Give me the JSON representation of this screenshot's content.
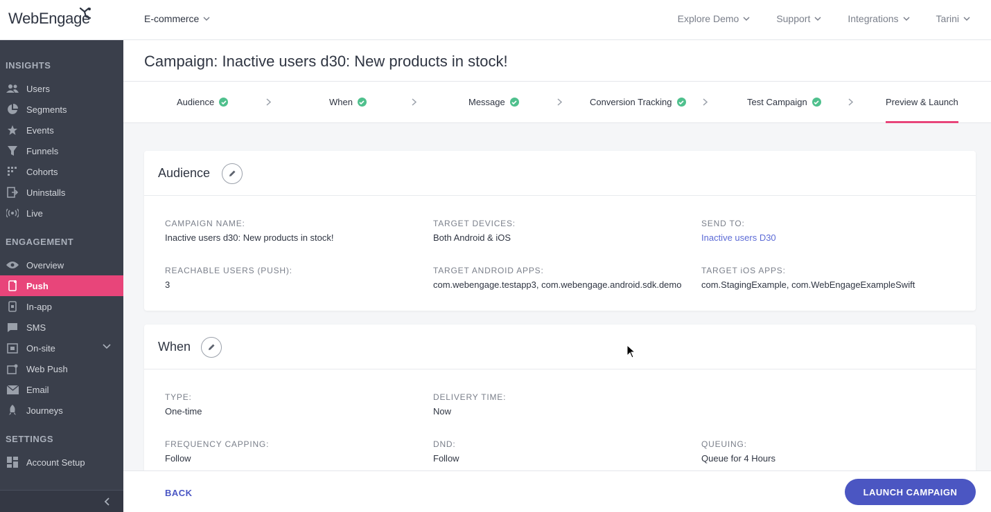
{
  "brand": {
    "logo_text": "WebEngage",
    "accent": "#e8457a",
    "primary": "#4b56c2"
  },
  "header": {
    "workspace": "E-commerce",
    "nav": [
      {
        "label": "Explore Demo"
      },
      {
        "label": "Support"
      },
      {
        "label": "Integrations"
      },
      {
        "label": "Tarini"
      }
    ]
  },
  "sidebar": {
    "sections": [
      {
        "title": "INSIGHTS"
      },
      {
        "title": "ENGAGEMENT"
      },
      {
        "title": "SETTINGS"
      }
    ],
    "items": [
      {
        "label": "Users",
        "icon": "users-icon"
      },
      {
        "label": "Segments",
        "icon": "pie-chart-icon"
      },
      {
        "label": "Events",
        "icon": "star-icon"
      },
      {
        "label": "Funnels",
        "icon": "funnel-icon"
      },
      {
        "label": "Cohorts",
        "icon": "grid-icon"
      },
      {
        "label": "Uninstalls",
        "icon": "exit-icon"
      },
      {
        "label": "Live",
        "icon": "broadcast-icon"
      },
      {
        "label": "Overview",
        "icon": "eye-icon"
      },
      {
        "label": "Push",
        "icon": "mobile-icon",
        "active": true
      },
      {
        "label": "In-app",
        "icon": "in-app-icon"
      },
      {
        "label": "SMS",
        "icon": "sms-icon"
      },
      {
        "label": "On-site",
        "icon": "on-site-icon"
      },
      {
        "label": "Web Push",
        "icon": "web-push-icon"
      },
      {
        "label": "Email",
        "icon": "envelope-icon"
      },
      {
        "label": "Journeys",
        "icon": "rocket-icon"
      },
      {
        "label": "Account Setup",
        "icon": "dashboard-icon"
      }
    ]
  },
  "page": {
    "title": "Campaign: Inactive users d30: New products in stock!"
  },
  "steps": [
    {
      "label": "Audience",
      "done": true
    },
    {
      "label": "When",
      "done": true
    },
    {
      "label": "Message",
      "done": true
    },
    {
      "label": "Conversion Tracking",
      "done": true
    },
    {
      "label": "Test Campaign",
      "done": true
    },
    {
      "label": "Preview & Launch",
      "current": true
    }
  ],
  "audience_card": {
    "title": "Audience",
    "fields": {
      "campaign_name": {
        "label": "CAMPAIGN NAME:",
        "value": "Inactive users d30: New products in stock!"
      },
      "target_devices": {
        "label": "TARGET DEVICES:",
        "value": "Both Android & iOS"
      },
      "send_to": {
        "label": "SEND TO:",
        "value": "Inactive users D30"
      },
      "reachable_users": {
        "label": "REACHABLE USERS (PUSH):",
        "value": "3"
      },
      "android_apps": {
        "label": "TARGET ANDROID APPS:",
        "value": "com.webengage.testapp3, com.webengage.android.sdk.demo"
      },
      "ios_apps": {
        "label": "TARGET iOS APPS:",
        "value": "com.StagingExample, com.WebEngageExampleSwift"
      }
    }
  },
  "when_card": {
    "title": "When",
    "fields": {
      "type": {
        "label": "TYPE:",
        "value": "One-time"
      },
      "delivery_time": {
        "label": "DELIVERY TIME:",
        "value": "Now"
      },
      "frequency_capping": {
        "label": "FREQUENCY CAPPING:",
        "value": "Follow"
      },
      "dnd": {
        "label": "DND:",
        "value": "Follow"
      },
      "queuing": {
        "label": "QUEUING:",
        "value": "Queue for 4 Hours"
      }
    }
  },
  "footer": {
    "back_label": "BACK",
    "launch_label": "LAUNCH CAMPAIGN"
  }
}
